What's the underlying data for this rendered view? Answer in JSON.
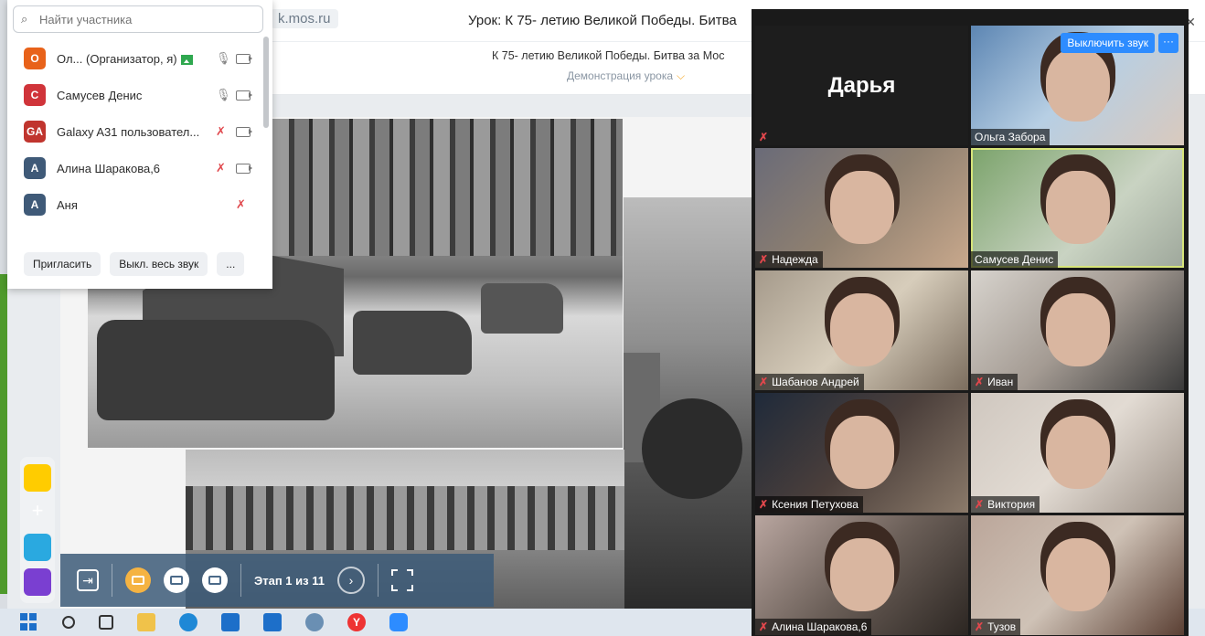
{
  "browser": {
    "url_fragment": "k.mos.ru",
    "lesson_title": "Урок: К 75- летию Великой Победы. Битва",
    "subtitle": "К 75- летию Великой Победы. Битва за Мос",
    "mode_label": "Демонстрация урока",
    "mode_chevron": "⌵"
  },
  "participants_panel": {
    "search_placeholder": "Найти участника",
    "items": [
      {
        "initials": "O",
        "name": "Ол... (Организатор, я)",
        "color": "#e8621a",
        "mic": "on",
        "camera": true,
        "sharing": true
      },
      {
        "initials": "C",
        "name": "Самусев Денис",
        "color": "#d0343a",
        "mic": "on",
        "camera": true,
        "sharing": false
      },
      {
        "initials": "GA",
        "name": "Galaxy A31 пользовател...",
        "color": "#c0352e",
        "mic": "off",
        "camera": true,
        "sharing": false
      },
      {
        "initials": "A",
        "name": "Алина Шаракова,6",
        "color": "#3f5a78",
        "mic": "off",
        "camera": true,
        "sharing": false
      },
      {
        "initials": "A",
        "name": "Аня",
        "color": "#3f5a78",
        "mic": "off",
        "camera": false,
        "sharing": false
      }
    ],
    "invite_label": "Пригласить",
    "mute_all_label": "Выкл. весь звук",
    "more_label": "..."
  },
  "slide_controls": {
    "stage_label": "Этап 1 из 11",
    "next_symbol": "›",
    "exit_symbol": "⇥"
  },
  "zoom": {
    "mute_button_label": "Выключить звук",
    "more_label": "···",
    "tiles": [
      {
        "name": "Дарья",
        "muted": true,
        "video": false
      },
      {
        "name": "Ольга Забора",
        "muted": false,
        "video": true
      },
      {
        "name": "Надежда",
        "muted": true,
        "video": true
      },
      {
        "name": "Самусев Денис",
        "muted": false,
        "video": true,
        "selected": true
      },
      {
        "name": "Шабанов Андрей",
        "muted": true,
        "video": true
      },
      {
        "name": "Иван",
        "muted": true,
        "video": true
      },
      {
        "name": "Ксения Петухова",
        "muted": true,
        "video": true
      },
      {
        "name": "Виктория",
        "muted": true,
        "video": true
      },
      {
        "name": "Алина Шаракова,6",
        "muted": true,
        "video": true
      },
      {
        "name": "Тузов",
        "muted": true,
        "video": true
      }
    ]
  },
  "taskbar": {
    "icons": [
      "windows-start-icon",
      "search-icon",
      "task-view-icon",
      "file-explorer-icon",
      "edge-icon",
      "mail-icon",
      "store-icon",
      "paint-icon",
      "yandex-browser-icon",
      "zoom-icon"
    ]
  },
  "muted_icon": "✗",
  "mic_icon": "🎙"
}
